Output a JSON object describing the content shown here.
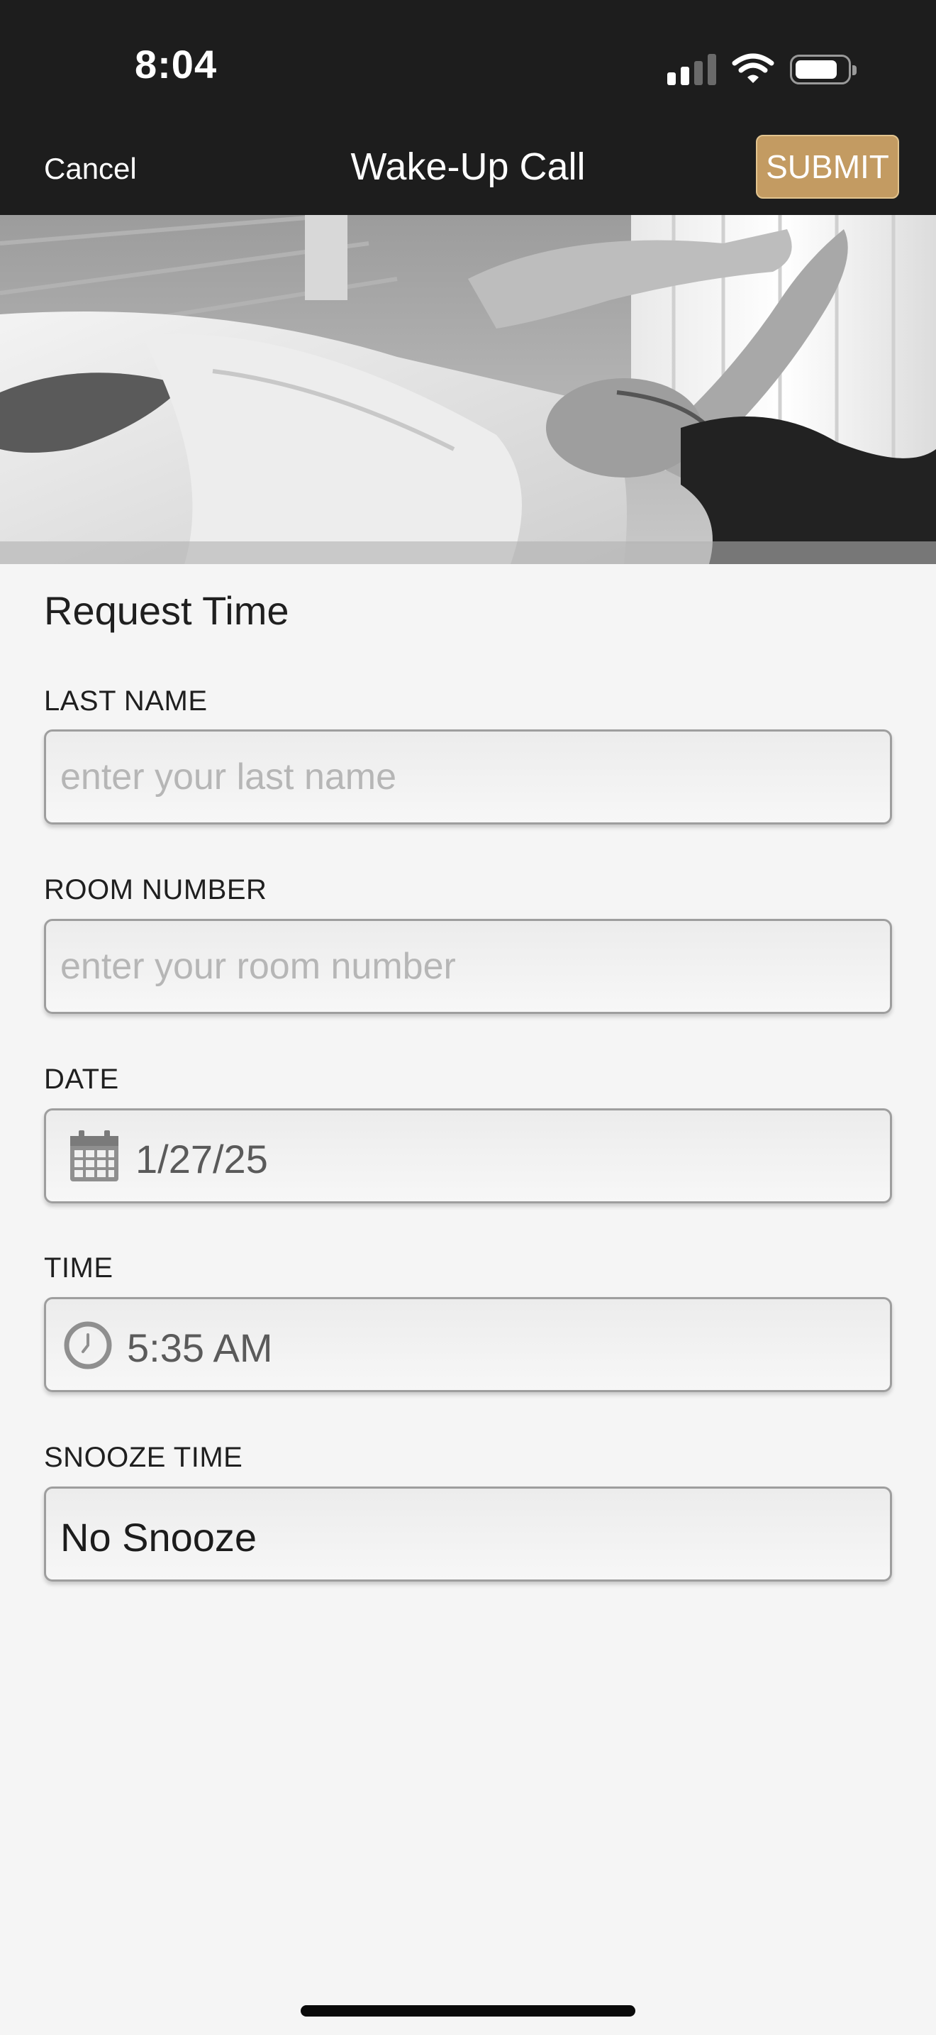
{
  "status_bar": {
    "time": "8:04",
    "icons": [
      "signal-icon",
      "wifi-icon",
      "battery-icon"
    ]
  },
  "nav": {
    "cancel_label": "Cancel",
    "title": "Wake-Up Call",
    "submit_label": "SUBMIT",
    "accent_color": "#c39b62"
  },
  "hero": {
    "image": "woman-waking-up-in-bed-photo"
  },
  "form": {
    "section_title": "Request Time",
    "last_name": {
      "label": "LAST NAME",
      "placeholder": "enter your last name",
      "value": ""
    },
    "room_number": {
      "label": "ROOM NUMBER",
      "placeholder": "enter your room number",
      "value": ""
    },
    "date": {
      "label": "DATE",
      "value": "1/27/25",
      "icon": "calendar-icon"
    },
    "time": {
      "label": "TIME",
      "value": "5:35 AM",
      "icon": "clock-icon"
    },
    "snooze": {
      "label": "SNOOZE TIME",
      "value": "No Snooze"
    }
  }
}
